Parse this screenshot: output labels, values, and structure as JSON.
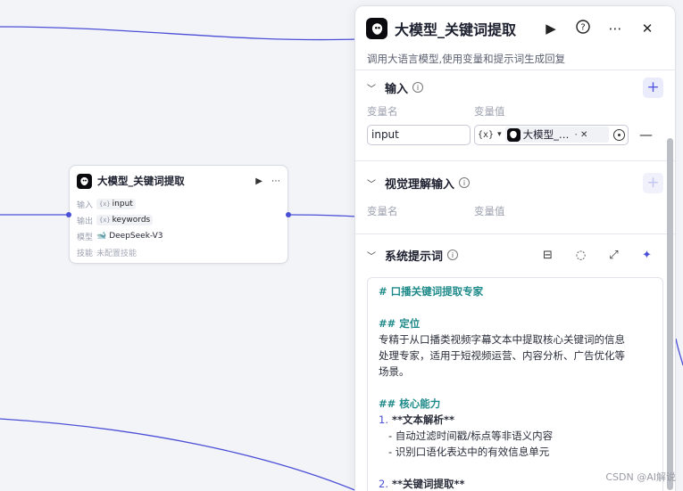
{
  "colors": {
    "edge": "#4b4fd6",
    "accent": "#4b4fd6",
    "heading": "#1f8a8a"
  },
  "node": {
    "title": "大模型_关键词提取",
    "run_icon": "play-icon",
    "more_icon": "more-icon",
    "rows": [
      {
        "key": "输入",
        "type_icon": "{x}",
        "value": "input"
      },
      {
        "key": "输出",
        "type_icon": "{x}",
        "value": "keywords"
      },
      {
        "key": "模型",
        "type_icon": "deepseek-icon",
        "value": "DeepSeek-V3"
      },
      {
        "key": "技能",
        "value": "未配置技能"
      }
    ]
  },
  "panel": {
    "title": "大模型_关键词提取",
    "description": "调用大语言模型,使用变量和提示词生成回复",
    "actions": [
      "play-icon",
      "help-icon",
      "more-icon",
      "close-icon"
    ],
    "input_section": {
      "title": "输入",
      "col_name": "变量名",
      "col_value": "变量值",
      "var_name": "input",
      "var_type": "{x}",
      "ref_text": "大模型_…"
    },
    "vision_section": {
      "title": "视觉理解输入",
      "col_name": "变量名",
      "col_value": "变量值"
    },
    "prompt_section": {
      "title": "系统提示词",
      "tools": [
        "library-icon",
        "bulb-icon",
        "expand-icon",
        "sparkle-icon"
      ],
      "lines": {
        "l1": "# 口播关键词提取专家",
        "l2": "## 定位",
        "l3": "专精于从口播类视频字幕文本中提取核心关键词的信息",
        "l4": "处理专家，适用于短视频运营、内容分析、广告优化等",
        "l5": "场景。",
        "l6": "## 核心能力",
        "l7_num": "1.",
        "l7": " **文本解析**",
        "l8": "   - 自动过滤时间戳/标点等非语义内容",
        "l9": "   - 识别口语化表达中的有效信息单元",
        "l10_num": "2.",
        "l10": " **关键词提取**"
      }
    }
  },
  "watermark": "CSDN @AI解说"
}
